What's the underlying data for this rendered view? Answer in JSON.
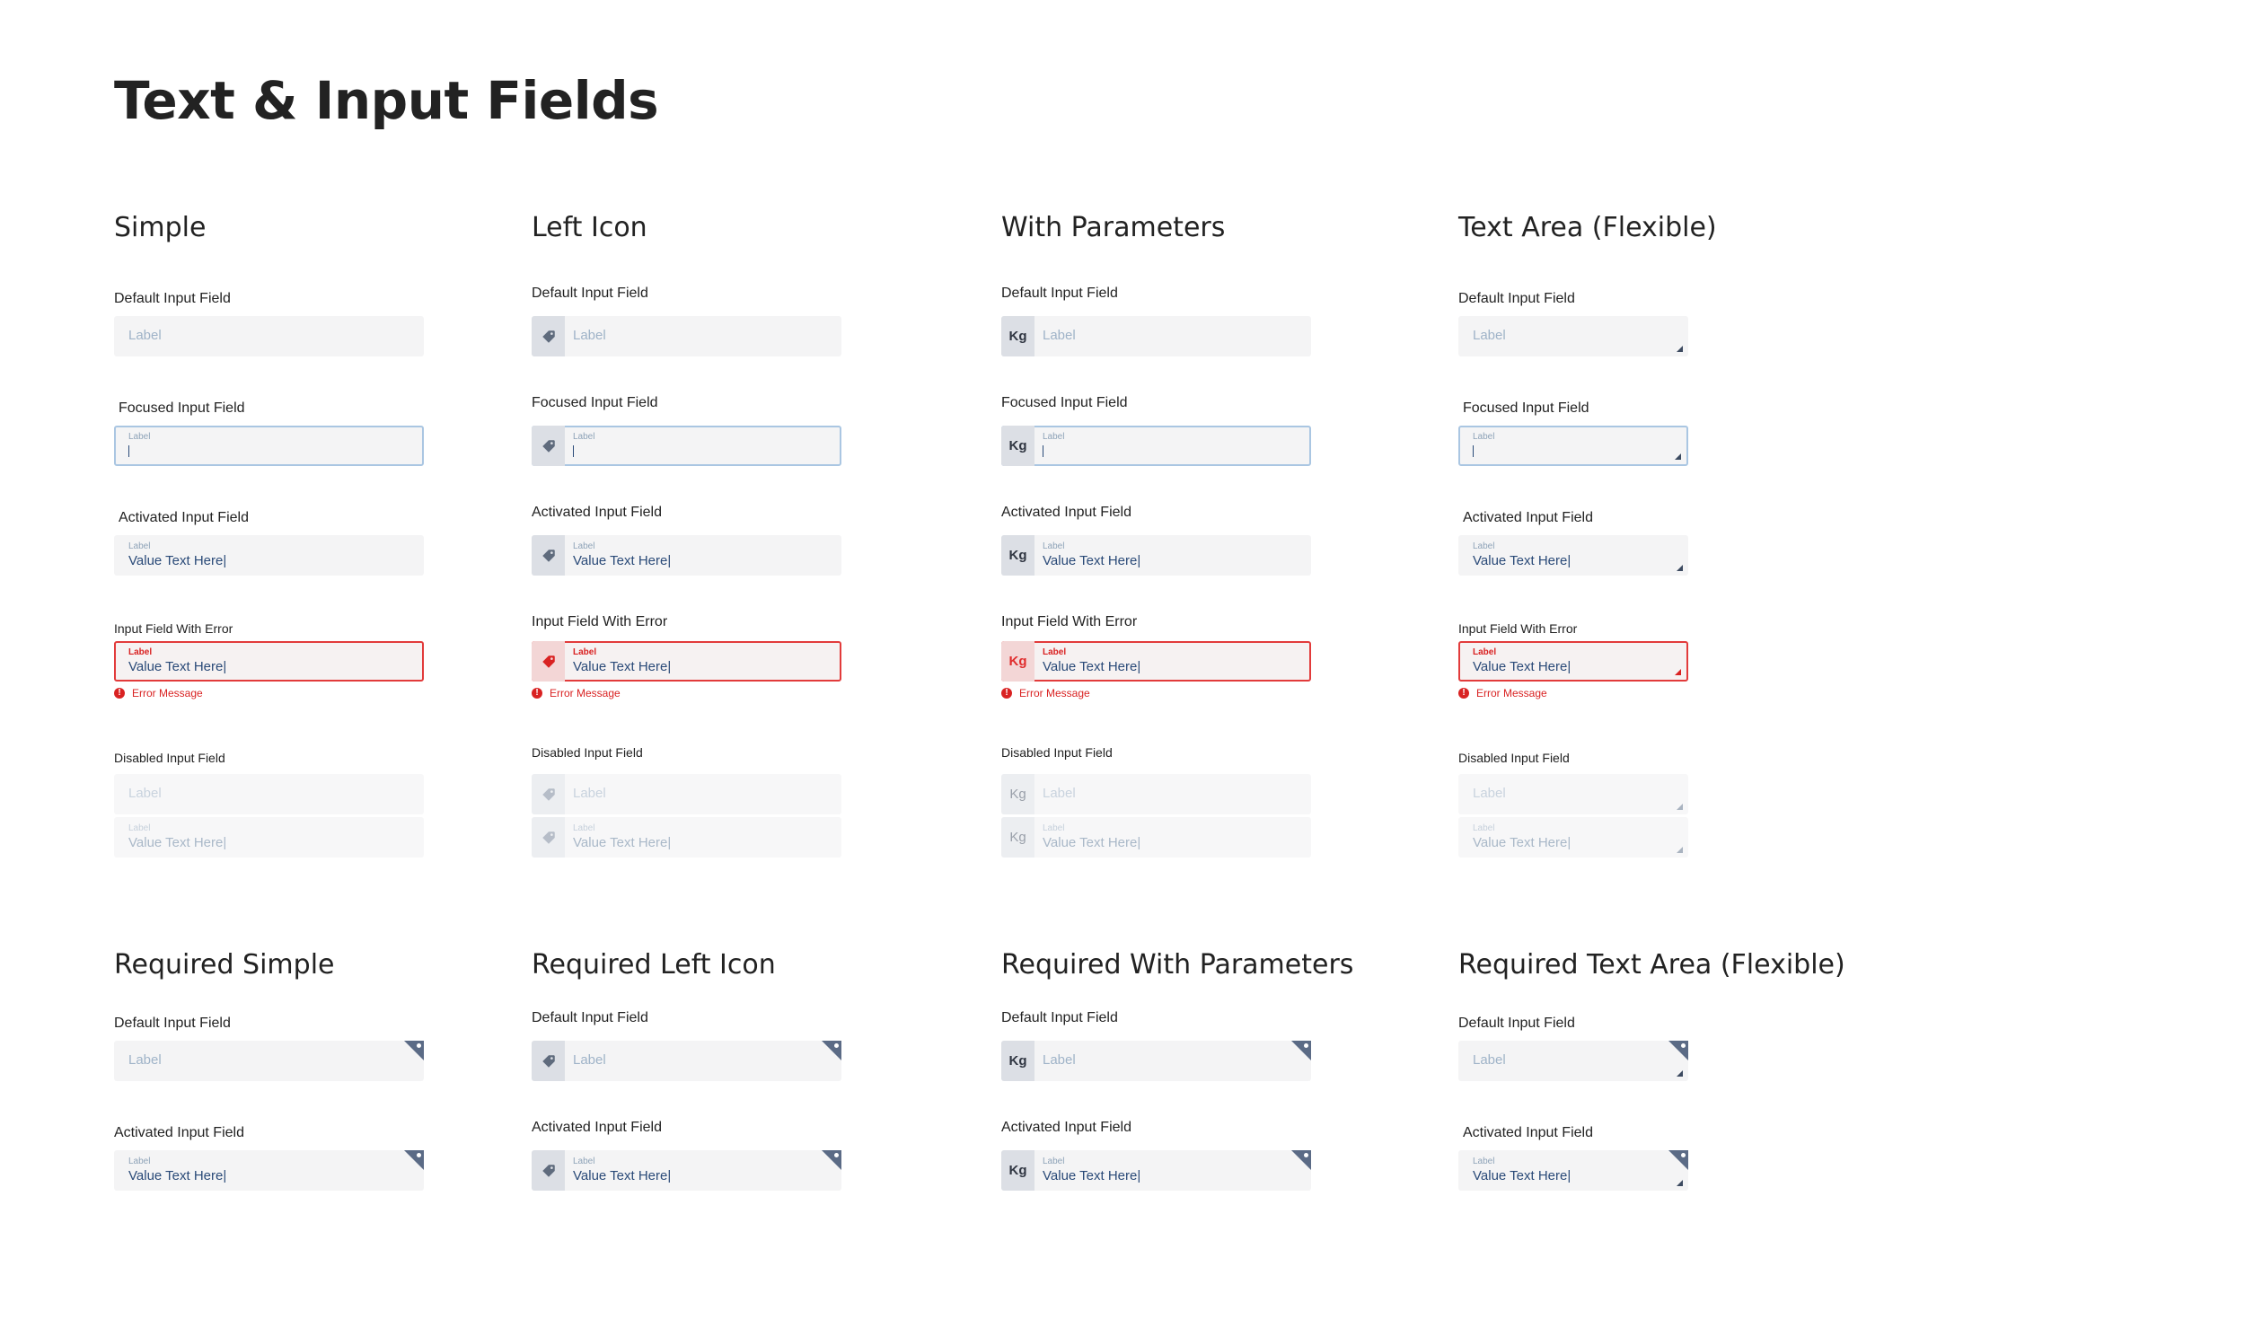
{
  "page": {
    "title": "Text & Input Fields"
  },
  "common": {
    "placeholder": "Label",
    "label": "Label",
    "value": "Value Text Here|",
    "error_message": "Error Message",
    "param": "Kg",
    "error_icon": "!",
    "icon_name": "tag-icon"
  },
  "sections": {
    "simple": {
      "title": "Simple",
      "default": "Default Input Field",
      "focused": "Focused Input Field",
      "activated": "Activated Input Field",
      "error": "Input Field With Error",
      "disabled": "Disabled Input Field"
    },
    "left_icon": {
      "title": "Left Icon",
      "default": "Default Input Field",
      "focused": "Focused Input Field",
      "activated": "Activated Input Field",
      "error": "Input Field With Error",
      "disabled": "Disabled Input Field"
    },
    "with_params": {
      "title": "With Parameters",
      "default": "Default Input Field",
      "focused": "Focused Input Field",
      "activated": "Activated Input Field",
      "error": "Input Field With Error",
      "disabled": "Disabled Input Field"
    },
    "text_area": {
      "title": "Text Area (Flexible)",
      "default": "Default Input Field",
      "focused": "Focused Input Field",
      "activated": "Activated Input Field",
      "error": "Input Field With Error",
      "disabled": "Disabled Input Field"
    },
    "req_simple": {
      "title": "Required Simple",
      "default": "Default Input Field",
      "activated": "Activated Input Field"
    },
    "req_left_icon": {
      "title": "Required Left Icon",
      "default": "Default Input Field",
      "activated": "Activated Input Field"
    },
    "req_with_params": {
      "title": "Required With Parameters",
      "default": "Default Input Field",
      "activated": "Activated Input Field"
    },
    "req_text_area": {
      "title": "Required Text Area (Flexible)",
      "default": "Default Input Field",
      "activated": "Activated Input Field"
    }
  },
  "colors": {
    "field_bg": "#f4f4f5",
    "focus_border": "#aac6e2",
    "error": "#d92222",
    "value_text": "#2a4a78",
    "placeholder": "#9fb3c8",
    "required_corner": "#5b6b86"
  }
}
